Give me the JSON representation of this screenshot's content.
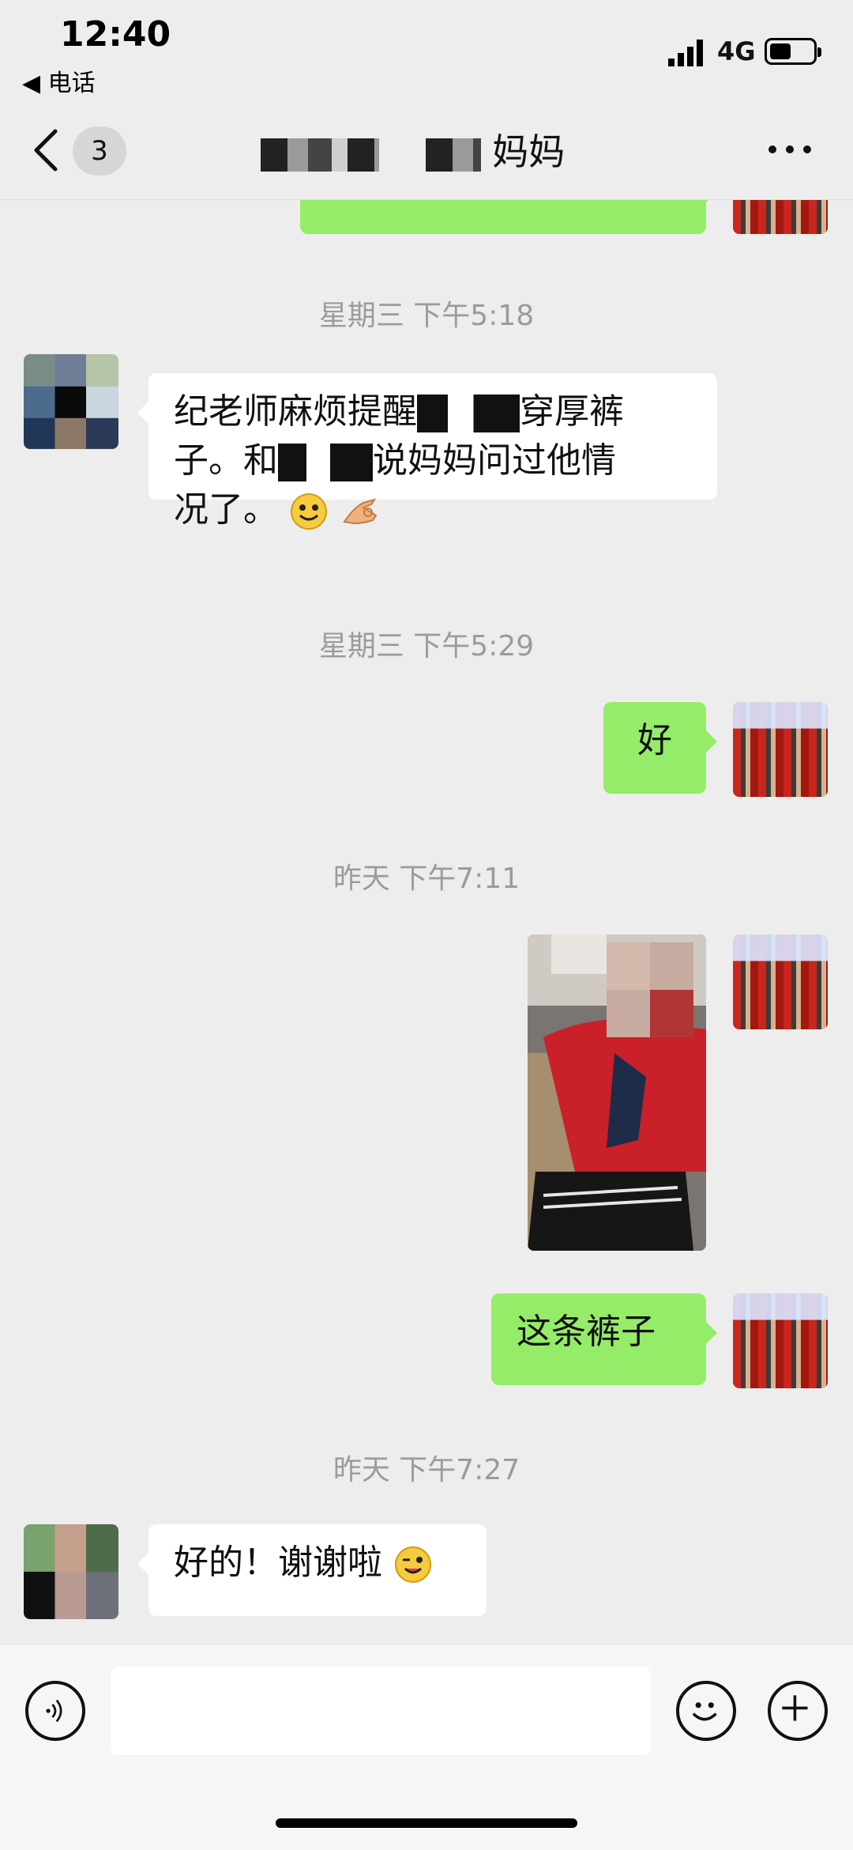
{
  "status_bar": {
    "time": "12:40",
    "back_app": "◀ 电话",
    "network": "4G"
  },
  "nav": {
    "unread_count": "3",
    "title_suffix": "妈妈"
  },
  "messages": {
    "top_partial": "",
    "time1": "星期三 下午5:18",
    "msg1_line1_a": "纪老师麻烦提醒",
    "msg1_line1_b": "穿厚裤",
    "msg1_line2_a": "子。和",
    "msg1_line2_b": "说妈妈问过他情",
    "msg1_line3": "况了。",
    "time2": "星期三 下午5:29",
    "msg2": "好",
    "time3": "昨天 下午7:11",
    "msg4": "这条裤子",
    "time4": "昨天 下午7:27",
    "msg5": "好的！谢谢啦"
  },
  "icons": {
    "back": "chevron-left-icon",
    "more": "more-icon",
    "voice": "voice-icon",
    "emoji": "emoji-icon",
    "plus": "plus-icon"
  },
  "colors": {
    "bubble_out": "#95ec69",
    "bubble_in": "#ffffff",
    "background": "#ededed"
  }
}
